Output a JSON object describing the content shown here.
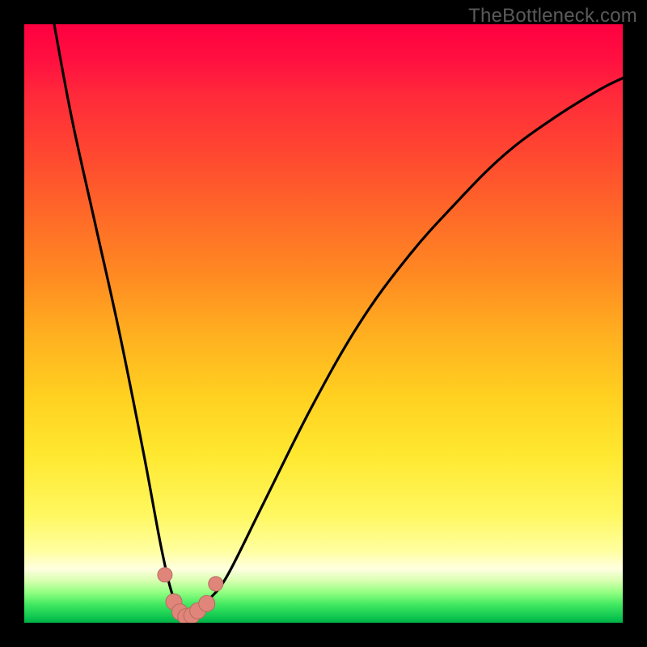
{
  "watermark": "TheBottleneck.com",
  "colors": {
    "background": "#000000",
    "curve": "#000000",
    "marker_fill": "#e0857a",
    "marker_stroke": "#b86a60"
  },
  "chart_data": {
    "type": "line",
    "title": "",
    "xlabel": "",
    "ylabel": "",
    "xlim": [
      0,
      100
    ],
    "ylim": [
      0,
      100
    ],
    "grid": false,
    "note": "V-shaped bottleneck curve; values are 0–100 percentages estimated from axis-free figure. y≈0 is green (good), y≈100 is red (bad). Minimum/optimal zone around x≈27.",
    "series": [
      {
        "name": "bottleneck-curve",
        "x": [
          5,
          8,
          12,
          16,
          20,
          23,
          25,
          27,
          29,
          31,
          34,
          40,
          48,
          56,
          64,
          72,
          80,
          88,
          96,
          100
        ],
        "y": [
          100,
          84,
          66,
          48,
          28,
          12,
          4,
          1,
          2,
          4,
          8,
          20,
          36,
          50,
          61,
          70,
          78,
          84,
          89,
          91
        ]
      }
    ],
    "markers": {
      "name": "highlighted-points",
      "x": [
        23.5,
        25.0,
        26.0,
        27.0,
        28.0,
        29.0,
        30.5,
        32.0
      ],
      "y": [
        8.0,
        3.5,
        1.8,
        1.0,
        1.2,
        2.0,
        3.2,
        6.5
      ]
    }
  }
}
